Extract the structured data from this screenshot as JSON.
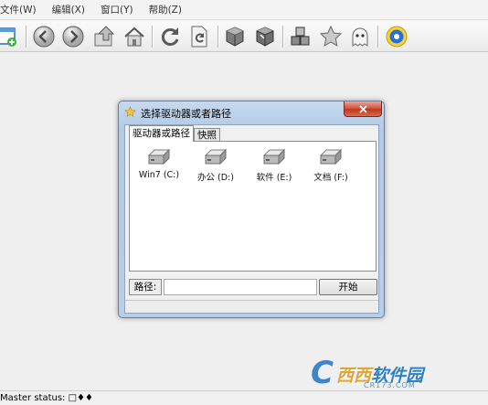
{
  "menu": {
    "items": [
      "文件(W)",
      "编辑(X)",
      "窗口(Y)",
      "帮助(Z)"
    ]
  },
  "toolbar": {
    "buttons": [
      "new",
      "back",
      "forward",
      "up",
      "home",
      "refresh",
      "reload-document",
      "cube-dark",
      "cube-marked",
      "cubes",
      "favorite",
      "ghost",
      "settings"
    ]
  },
  "dialog": {
    "title": "选择驱动器或者路径",
    "tabs": [
      "驱动器或路径",
      "快照"
    ],
    "active_tab": "驱动器或路径",
    "drives": [
      {
        "label": "Win7 (C:)"
      },
      {
        "label": "办公 (D:)"
      },
      {
        "label": "软件 (E:)"
      },
      {
        "label": "文档 (F:)"
      }
    ],
    "path_label": "路径:",
    "path_value": "",
    "start_label": "开始"
  },
  "status": {
    "text": "Master status: □♦♦"
  },
  "watermark": {
    "letter": "C",
    "brand_first": "西西",
    "brand_rest": "软件园",
    "url": "CR173.COM"
  },
  "colors": {
    "dialog_frame": "#b8cde6",
    "close_button": "#d3573f",
    "watermark_blue": "#3f86c8",
    "watermark_orange": "#e1a33a"
  }
}
